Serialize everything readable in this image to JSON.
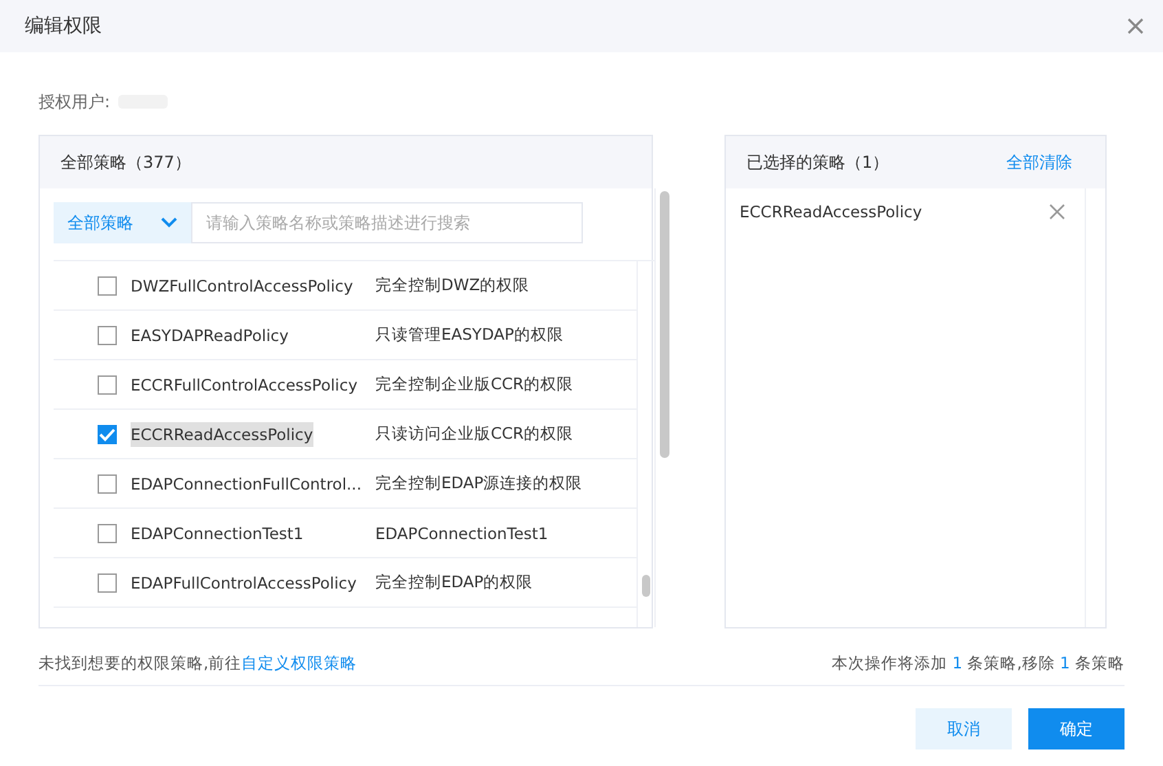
{
  "dialog": {
    "title": "编辑权限"
  },
  "user": {
    "label": "授权用户:"
  },
  "all_policies": {
    "title": "全部策略（377）",
    "filter": "全部策略",
    "search": {
      "placeholder": "请输入策略名称或策略描述进行搜索"
    },
    "rows": [
      {
        "name": "DWZFullControlAccessPolicy",
        "description": "完全控制DWZ的权限",
        "checked": false
      },
      {
        "name": "EASYDAPReadPolicy",
        "description": "只读管理EASYDAP的权限",
        "checked": false
      },
      {
        "name": "ECCRFullControlAccessPolicy",
        "description": "完全控制企业版CCR的权限",
        "checked": false
      },
      {
        "name": "ECCRReadAccessPolicy",
        "description": "只读访问企业版CCR的权限",
        "checked": true
      },
      {
        "name": "EDAPConnectionFullControl...",
        "description": "完全控制EDAP源连接的权限",
        "checked": false
      },
      {
        "name": "EDAPConnectionTest1",
        "description": "EDAPConnectionTest1",
        "checked": false
      },
      {
        "name": "EDAPFullControlAccessPolicy",
        "description": "完全控制EDAP的权限",
        "checked": false
      }
    ]
  },
  "selected_policies": {
    "title": "已选择的策略（1）",
    "clear_all": "全部清除",
    "items": [
      "ECCRReadAccessPolicy"
    ]
  },
  "footer": {
    "hint": "未找到想要的权限策略,前往",
    "link": "自定义权限策略",
    "summary": [
      "本次操作将添加 ",
      "1",
      " 条策略,移除 ",
      "1",
      " 条策略"
    ]
  },
  "buttons": {
    "cancel": "取消",
    "confirm": "确定"
  }
}
